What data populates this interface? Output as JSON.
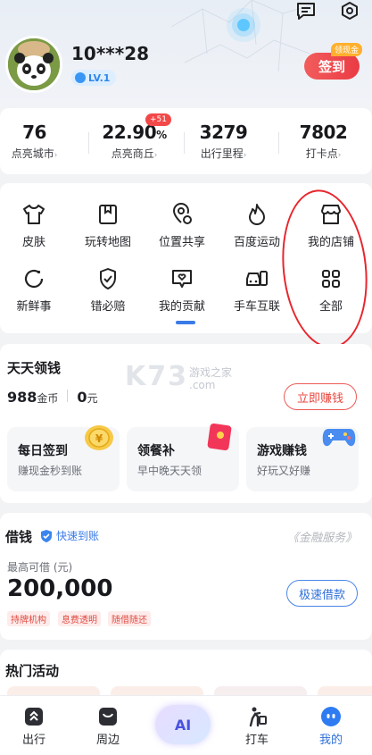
{
  "header": {
    "username": "10***28",
    "level": "LV.1",
    "sign_button": "签到",
    "sign_tag": "领现金"
  },
  "stats": [
    {
      "value": "76",
      "unit": "",
      "label": "点亮城市",
      "arrow": "›"
    },
    {
      "value": "22.90",
      "unit": "%",
      "label": "点亮商丘",
      "arrow": "›",
      "badge": "+51"
    },
    {
      "value": "3279",
      "unit": "",
      "label": "出行里程",
      "arrow": "›"
    },
    {
      "value": "7802",
      "unit": "",
      "label": "打卡点",
      "arrow": "›"
    }
  ],
  "grid": [
    {
      "label": "皮肤",
      "icon": "shirt-icon"
    },
    {
      "label": "玩转地图",
      "icon": "bookmark-icon"
    },
    {
      "label": "位置共享",
      "icon": "location-share-icon"
    },
    {
      "label": "百度运动",
      "icon": "flame-icon"
    },
    {
      "label": "我的店铺",
      "icon": "store-icon"
    },
    {
      "label": "新鲜事",
      "icon": "refresh-circle-icon"
    },
    {
      "label": "错必赔",
      "icon": "shield-check-icon"
    },
    {
      "label": "我的贡献",
      "icon": "heart-chat-icon"
    },
    {
      "label": "手车互联",
      "icon": "car-phone-icon"
    },
    {
      "label": "全部",
      "icon": "grid-icon"
    }
  ],
  "earn": {
    "title": "天天领钱",
    "coins_value": "988",
    "coins_unit": "金币",
    "cash_value": "0",
    "cash_unit": "元",
    "button": "立即赚钱",
    "tasks": [
      {
        "title": "每日签到",
        "sub": "赚现金秒到账",
        "icon": "gold-coin-icon"
      },
      {
        "title": "领餐补",
        "sub": "早中晚天天领",
        "icon": "red-envelope-icon"
      },
      {
        "title": "游戏赚钱",
        "sub": "好玩又好赚",
        "icon": "gamepad-icon"
      }
    ]
  },
  "loan": {
    "title": "借钱",
    "fast_label": "快速到账",
    "service": "《金融服务》",
    "limit_label": "最高可借 (元)",
    "amount": "200,000",
    "button": "极速借款",
    "tags": [
      "持牌机构",
      "息费透明",
      "随借随还"
    ]
  },
  "hot": {
    "title": "热门活动"
  },
  "watermark": {
    "main": "K73",
    "sub": "游戏之家",
    "domain": ".com"
  },
  "nav": [
    {
      "label": "出行",
      "icon": "travel-icon"
    },
    {
      "label": "周边",
      "icon": "nearby-icon"
    },
    {
      "label": "AI",
      "icon": "ai-icon"
    },
    {
      "label": "打车",
      "icon": "taxi-icon"
    },
    {
      "label": "我的",
      "icon": "profile-icon",
      "active": true
    }
  ],
  "colors": {
    "accent": "#3a7be8",
    "red": "#ea3b44",
    "annotation": "#e8262d"
  }
}
